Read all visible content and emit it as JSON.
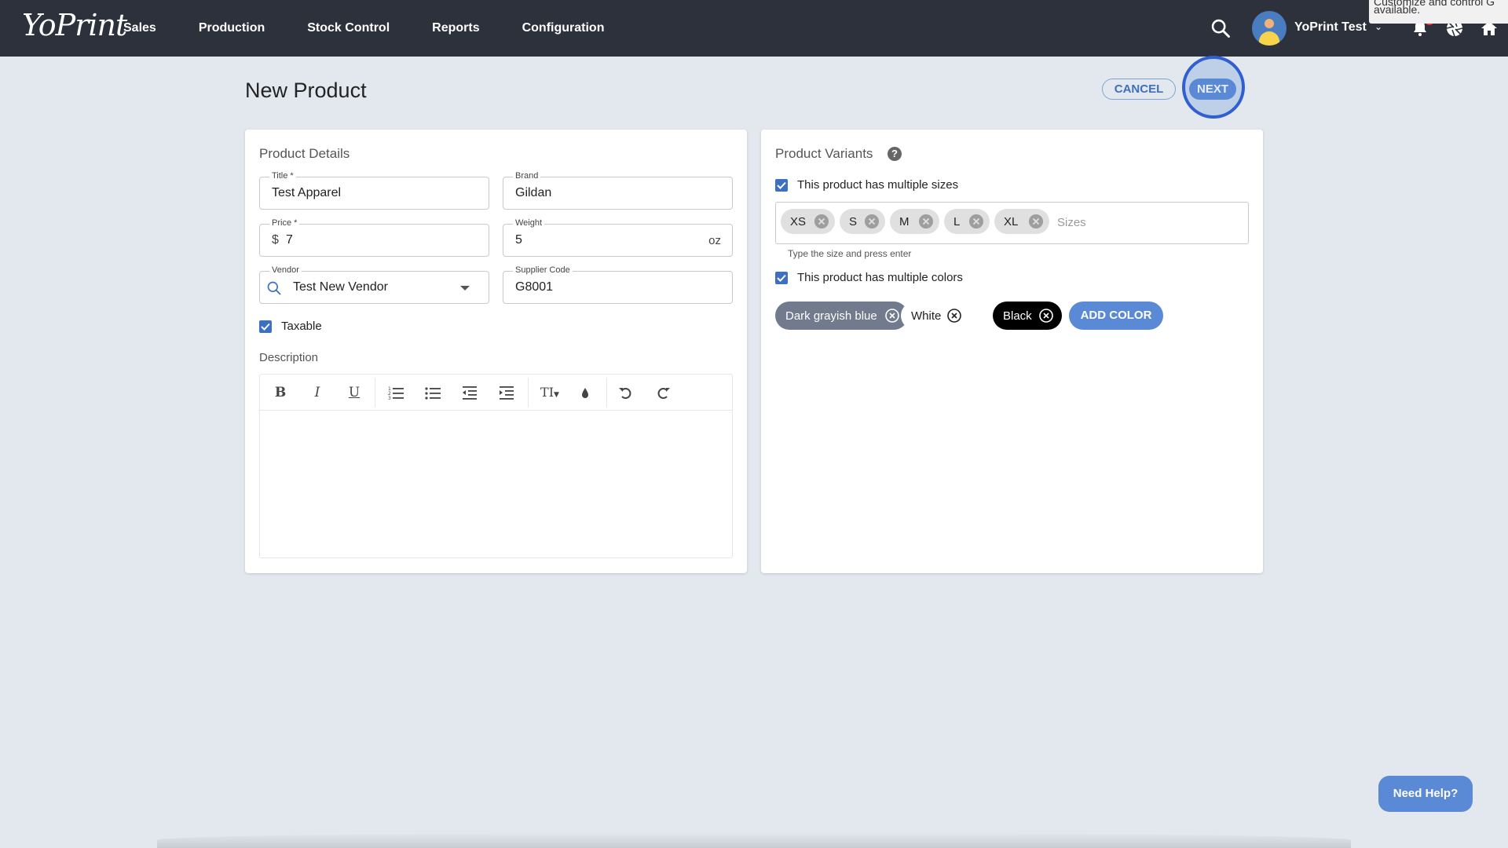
{
  "nav": {
    "logo": "YoPrint",
    "items": [
      "Sales",
      "Production",
      "Stock Control",
      "Reports",
      "Configuration"
    ],
    "user_name": "YoPrint Test",
    "tooltip_line1": "Customize and control G",
    "tooltip_line2": "available."
  },
  "page": {
    "title": "New Product",
    "cancel_label": "CANCEL",
    "next_label": "NEXT"
  },
  "product_details": {
    "heading": "Product Details",
    "title_label": "Title *",
    "title_value": "Test Apparel",
    "brand_label": "Brand",
    "brand_value": "Gildan",
    "price_label": "Price *",
    "price_prefix": "$",
    "price_value": "7",
    "weight_label": "Weight",
    "weight_value": "5",
    "weight_unit": "oz",
    "vendor_label": "Vendor",
    "vendor_value": "Test New Vendor",
    "supplier_code_label": "Supplier Code",
    "supplier_code_value": "G8001",
    "taxable_label": "Taxable",
    "taxable_checked": true,
    "description_label": "Description",
    "toolbar": {
      "bold": "B",
      "italic": "I",
      "underline": "U",
      "text_size": "TI"
    }
  },
  "variants": {
    "heading": "Product Variants",
    "help": "?",
    "multiple_sizes_label": "This product has multiple sizes",
    "multiple_sizes_checked": true,
    "sizes": [
      "XS",
      "S",
      "M",
      "L",
      "XL"
    ],
    "sizes_placeholder": "Sizes",
    "sizes_help": "Type the size and press enter",
    "multiple_colors_label": "This product has multiple colors",
    "multiple_colors_checked": true,
    "colors": [
      {
        "name": "Dark grayish blue",
        "bg": "#717b8d",
        "fg": "#ffffff"
      },
      {
        "name": "White",
        "bg": "#ffffff",
        "fg": "#222222"
      },
      {
        "name": "Black",
        "bg": "#000000",
        "fg": "#ffffff"
      }
    ],
    "add_color_label": "ADD COLOR"
  },
  "help_button": "Need Help?",
  "colors": {
    "nav_bg": "#2c313c",
    "page_bg": "#e3e8ef",
    "accent": "#5a8ad6",
    "checkbox": "#3d6fc2"
  }
}
